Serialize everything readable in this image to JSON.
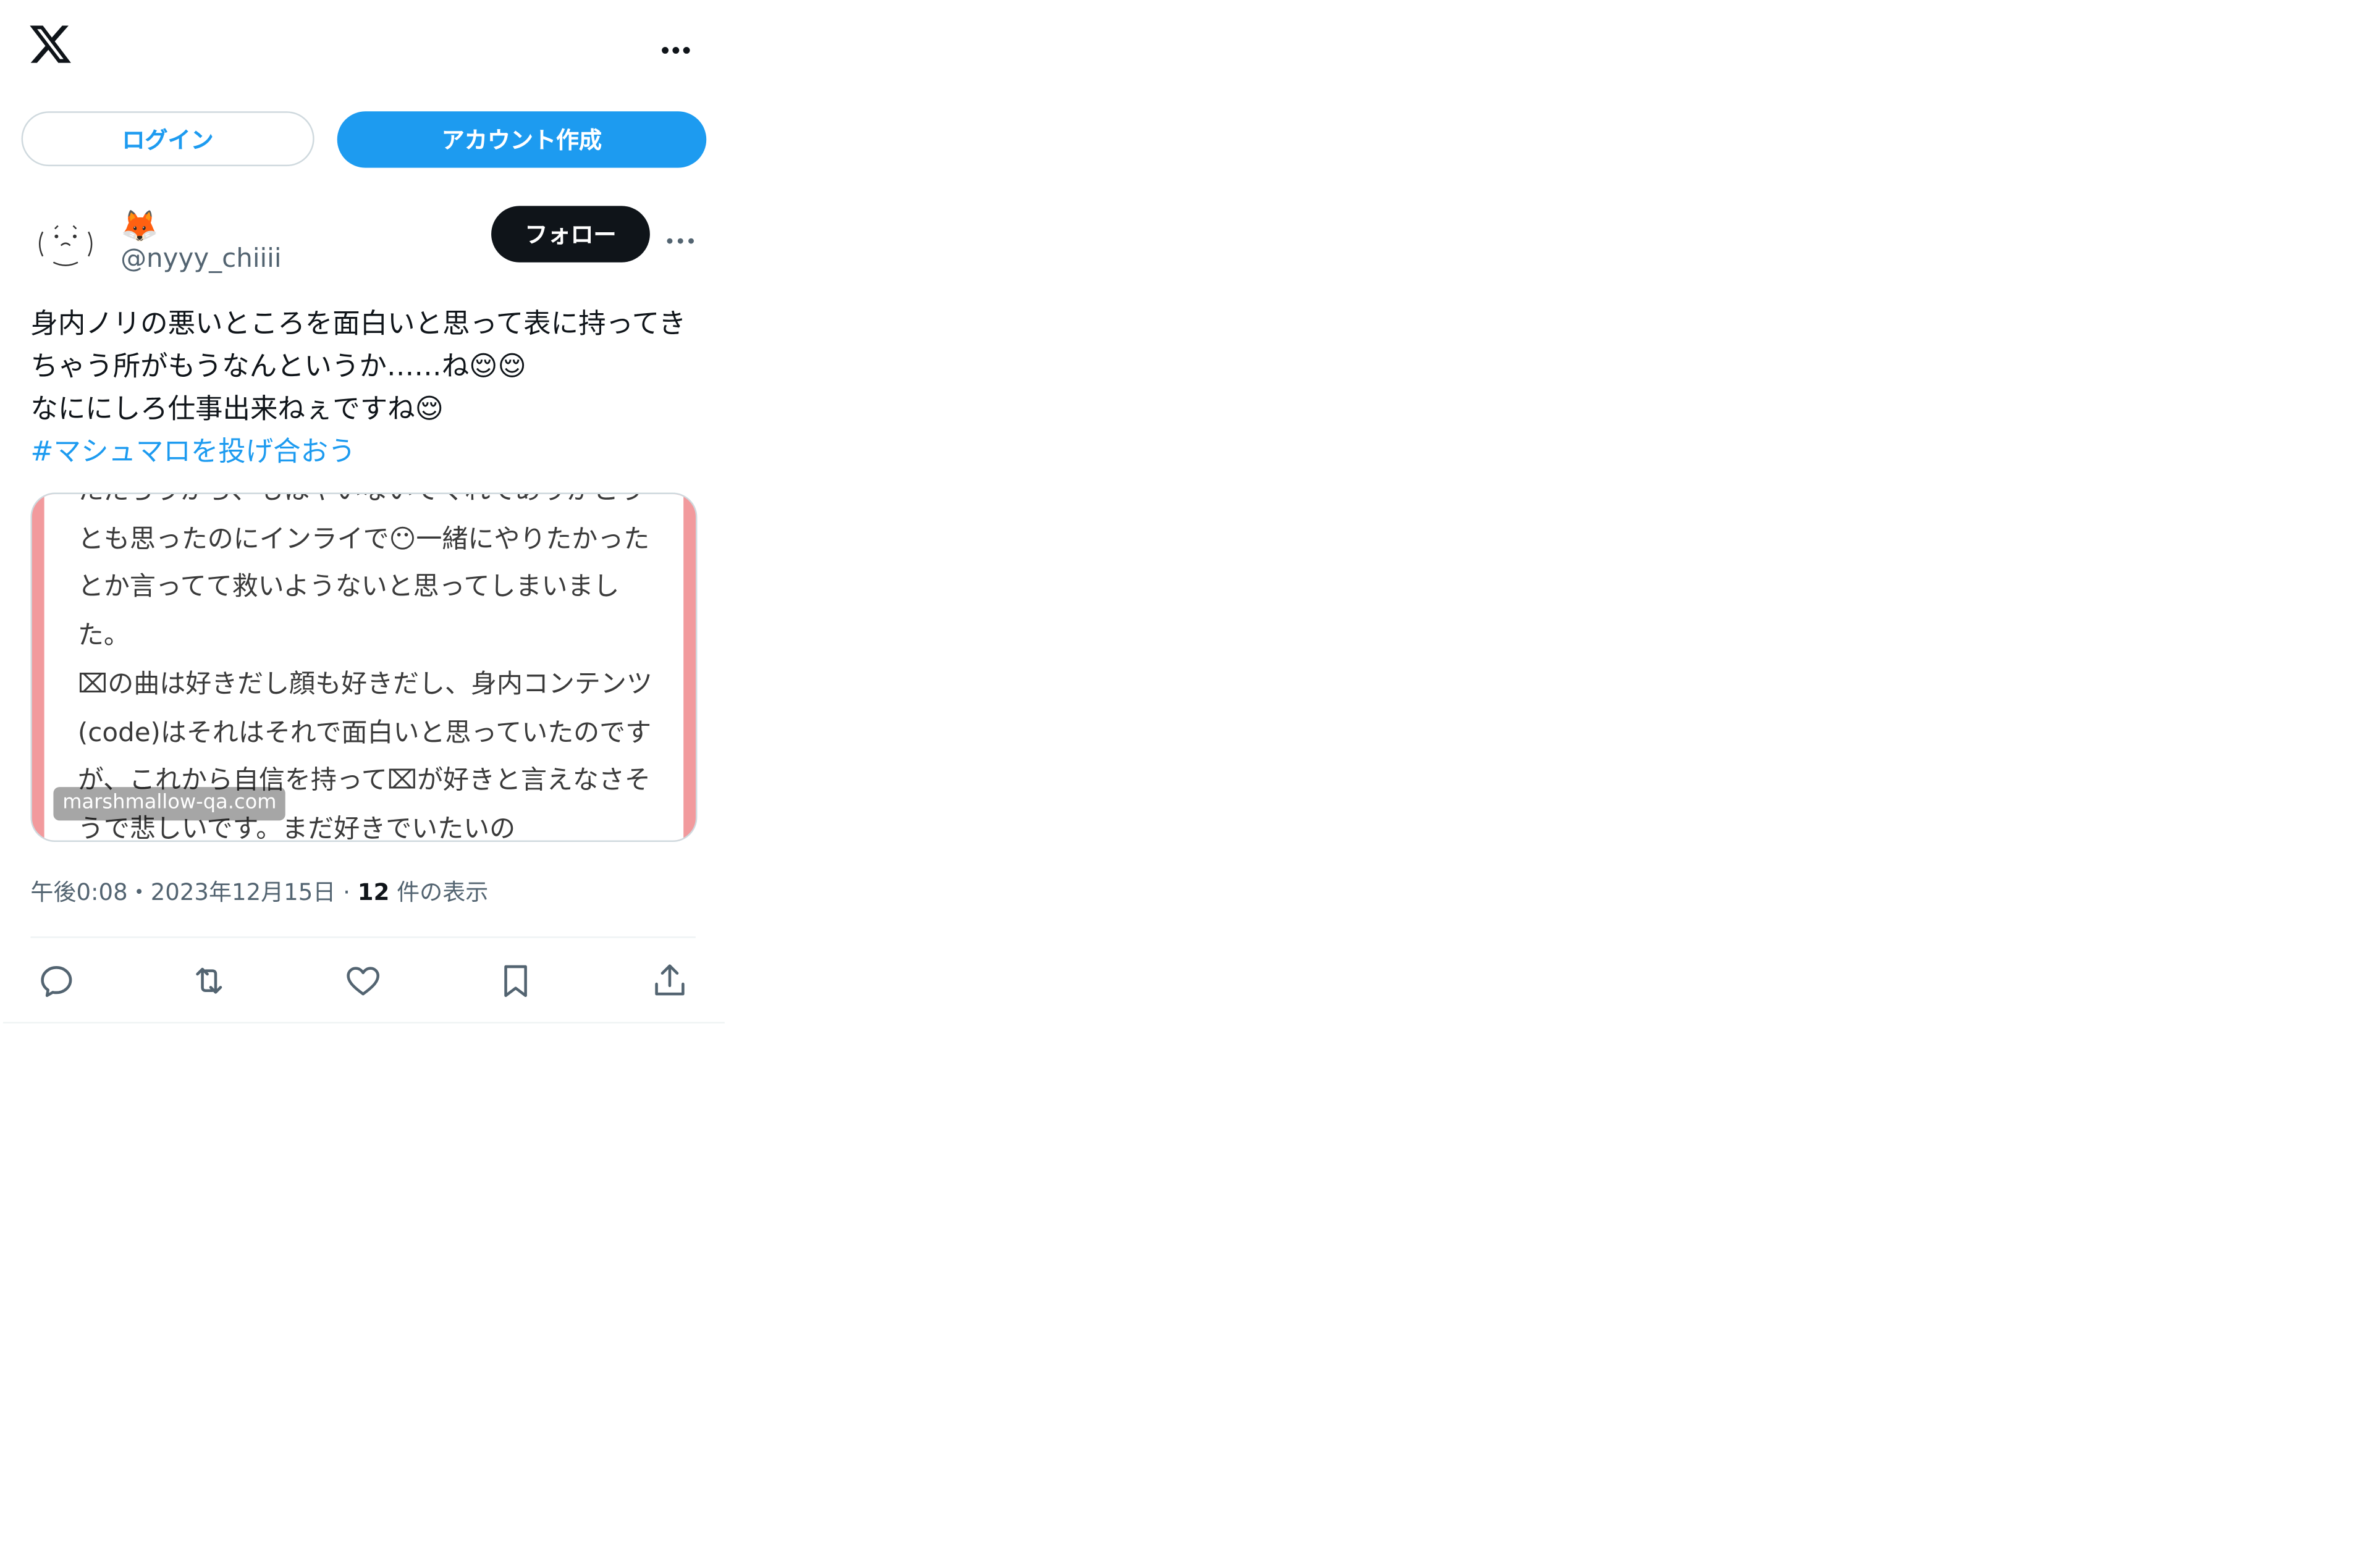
{
  "header": {
    "logo_icon": "x-logo-icon",
    "more_icon": "more-horizontal-icon"
  },
  "auth": {
    "login_label": "ログイン",
    "signup_label": "アカウント作成"
  },
  "post": {
    "author": {
      "display_name_emoji": "🦊",
      "handle": "@nyyy_chiiii"
    },
    "follow_label": "フォロー",
    "text": "身内ノリの悪いところを面白いと思って表に持ってきちゃう所がもうなんというか……ね😌😌\nなににしろ仕事出来ねぇですね😌",
    "hashtag": "#マシュマロを投げ合おう",
    "media": {
      "text": "ただろうから、もはやいないでくれてありがとうとも思ったのにインライで😶一緒にやりたかったとか言ってて救いようないと思ってしまいました。\n⌧の曲は好きだし顔も好きだし、身内コンテンツ(code)はそれはそれで面白いと思っていたのですが、これから自信を持って⌧が好きと言えなさそうで悲しいです。まだ好きでいたいの",
      "source": "marshmallow-qa.com"
    },
    "meta": {
      "time": "午後0:08",
      "separator": "・",
      "date": "2023年12月15日",
      "dot": "·",
      "views_count": "12",
      "views_label": "件の表示"
    },
    "actions": [
      "reply-icon",
      "repost-icon",
      "like-icon",
      "bookmark-icon",
      "share-icon"
    ]
  },
  "colors": {
    "accent": "#1d9bf0",
    "text_primary": "#0f1419",
    "text_secondary": "#536471",
    "border": "#cfd9de",
    "media_frame": "#f29a9d"
  }
}
